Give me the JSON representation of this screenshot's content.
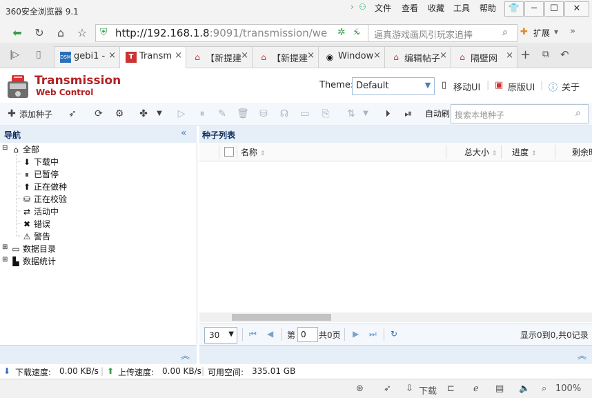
{
  "browser": {
    "title": "360安全浏览器 9.1",
    "menus": [
      "文件",
      "查看",
      "收藏",
      "工具",
      "帮助"
    ],
    "window_buttons": [
      "👕",
      "─",
      "☐",
      "✕"
    ],
    "url_host": "http://192.168.1.8",
    "url_rest": ":9091/transmission/we",
    "search_placeholder": "逼真游戏画风引玩家追捧",
    "extend_label": "扩展",
    "tabs": [
      {
        "icon": "DSM",
        "label": "gebi1 -"
      },
      {
        "icon": "T",
        "label": "Transm"
      },
      {
        "icon": "⌂",
        "label": "【新提建"
      },
      {
        "icon": "⌂",
        "label": "【新提建"
      },
      {
        "icon": "◉",
        "label": "Window"
      },
      {
        "icon": "⌂",
        "label": "编辑帖子"
      },
      {
        "icon": "⌂",
        "label": "隔壁网"
      }
    ],
    "new_tab": "+",
    "status_items": [
      "下载",
      "100%"
    ]
  },
  "app": {
    "brand": "Transmission",
    "brand_sub": "Web Control",
    "theme_label": "Theme:",
    "theme_value": "Default",
    "links": [
      "移动UI",
      "原版UI",
      "关于"
    ],
    "add_torrent": "添加种子",
    "auto_refresh": "自动刷",
    "local_search_placeholder": "搜索本地种子"
  },
  "nav": {
    "title": "导航",
    "items": [
      {
        "label": "全部",
        "icon": "⌂",
        "level": 0
      },
      {
        "label": "下载中",
        "icon": "⬇",
        "level": 1
      },
      {
        "label": "已暂停",
        "icon": "⏸",
        "level": 1
      },
      {
        "label": "正在做种",
        "icon": "⬆",
        "level": 1
      },
      {
        "label": "正在校验",
        "icon": "⛁",
        "level": 1
      },
      {
        "label": "活动中",
        "icon": "⇄",
        "level": 1
      },
      {
        "label": "错误",
        "icon": "✖",
        "level": 1
      },
      {
        "label": "警告",
        "icon": "⚠",
        "level": 1
      },
      {
        "label": "数据目录",
        "icon": "▭",
        "level": 0
      },
      {
        "label": "数据统计",
        "icon": "▙",
        "level": 0
      }
    ]
  },
  "list": {
    "title": "种子列表",
    "columns": [
      "名称",
      "总大小",
      "进度",
      "剩余时"
    ],
    "page_size": "30",
    "page_prefix": "第",
    "page_value": "0",
    "page_total": "共0页",
    "records": "显示0到0,共0记录"
  },
  "status": {
    "download_label": "下载速度:",
    "download_value": "0.00 KB/s",
    "upload_label": "上传速度:",
    "upload_value": "0.00 KB/s",
    "free_label": "可用空间:",
    "free_value": "335.01 GB"
  }
}
